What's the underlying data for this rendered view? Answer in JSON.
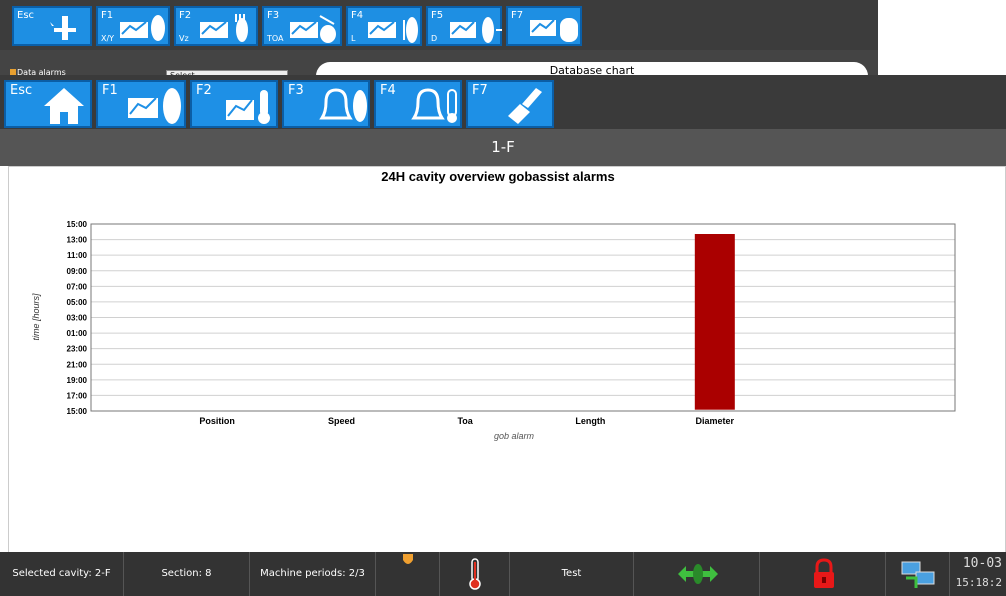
{
  "back_window": {
    "buttons": [
      {
        "key": "Esc",
        "sub": ""
      },
      {
        "key": "F1",
        "sub": "X/Y"
      },
      {
        "key": "F2",
        "sub": "Vz"
      },
      {
        "key": "F3",
        "sub": "TOA"
      },
      {
        "key": "F4",
        "sub": "L"
      },
      {
        "key": "F5",
        "sub": "D"
      },
      {
        "key": "F7",
        "sub": ""
      }
    ],
    "chart_title": "Database chart",
    "legend_label": "Data alarms",
    "select_value": "Select"
  },
  "toolbar": {
    "buttons": [
      {
        "key": "Esc",
        "icon": "home-icon"
      },
      {
        "key": "F1",
        "icon": "chart-gob-icon"
      },
      {
        "key": "F2",
        "icon": "chart-thermometer-icon"
      },
      {
        "key": "F3",
        "icon": "bell-gob-icon"
      },
      {
        "key": "F4",
        "icon": "bell-thermometer-icon"
      },
      {
        "key": "F7",
        "icon": "broom-icon"
      }
    ]
  },
  "window_title": "1-F",
  "chart_data": {
    "type": "bar",
    "title": "24H cavity overview gobassist alarms",
    "xlabel": "gob alarm",
    "ylabel": "time [hours]",
    "categories": [
      "Position",
      "Speed",
      "Toa",
      "Length",
      "Diameter"
    ],
    "y_ticks": [
      "15:00",
      "17:00",
      "19:00",
      "21:00",
      "23:00",
      "01:00",
      "03:00",
      "05:00",
      "07:00",
      "09:00",
      "11:00",
      "13:00",
      "15:00"
    ],
    "alarms": [
      {
        "category": "Diameter",
        "start": "14:30",
        "end": "15:10",
        "color": "#aa0000"
      }
    ],
    "grid": true
  },
  "status_bar": {
    "selected_cavity": "Selected cavity: 2-F",
    "section": "Section: 8",
    "machine_periods": "Machine periods: 2/3",
    "test": "Test",
    "date": "10-03",
    "time": "15:18:2"
  }
}
